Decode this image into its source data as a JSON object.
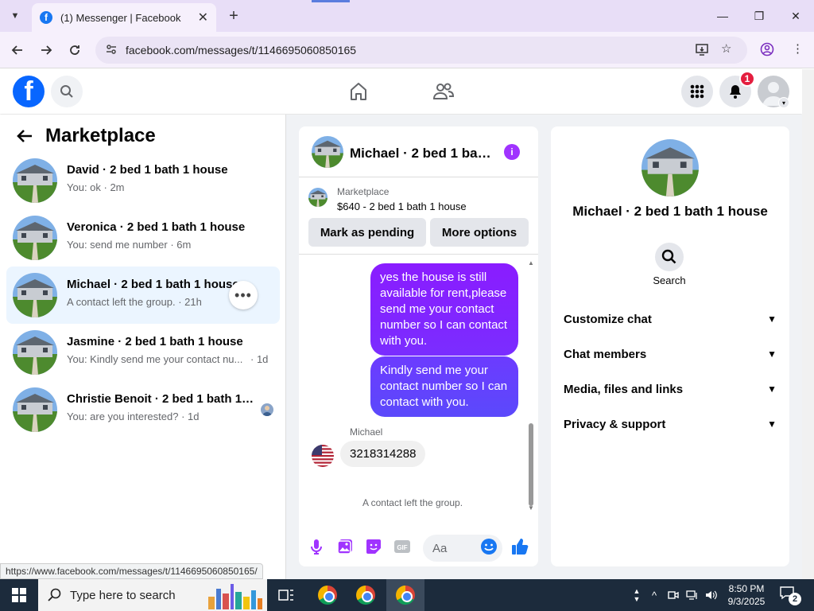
{
  "browser": {
    "tab_title": "(1) Messenger | Facebook",
    "tab_favicon": "facebook-icon",
    "new_tab_label": "+",
    "url": "facebook.com/messages/t/1146695060850165",
    "status_url": "https://www.facebook.com/messages/t/1146695060850165/"
  },
  "fb_header": {
    "logo_letter": "f",
    "notification_count": "1",
    "accent": "#0866ff",
    "badge_color": "#e41e3f"
  },
  "sidebar": {
    "title": "Marketplace",
    "conversations": [
      {
        "name": "David · 2 bed 1 bath 1 house",
        "preview": "You: ok · 2m",
        "time": ""
      },
      {
        "name": "Veronica · 2 bed 1 bath 1 house",
        "preview": "You: send me number · 6m",
        "time": ""
      },
      {
        "name": "Michael · 2 bed 1 bath 1 house",
        "preview": "A contact left the group. · 21h",
        "time": "",
        "active": true
      },
      {
        "name": "Jasmine · 2 bed 1 bath 1 house",
        "preview": "You: Kindly send me your contact nu...",
        "time": "· 1d"
      },
      {
        "name": "Christie Benoit · 2 bed 1 bath 1 h...",
        "preview": "You: are you interested? · 1d",
        "time": ""
      }
    ]
  },
  "chat": {
    "title": "Michael · 2 bed 1 bat...",
    "listing_label": "Marketplace",
    "listing_price": "$640 - 2 bed 1 bath 1 house",
    "mark_pending": "Mark as pending",
    "more_options": "More options",
    "messages": [
      {
        "from": "me",
        "text": "yes the house is still available for rent,please send me your contact number so I can contact with you."
      },
      {
        "from": "me",
        "text": "Kindly send me your contact number so I can contact with you."
      },
      {
        "from": "Michael",
        "text": "3218314288"
      }
    ],
    "sender_name": "Michael",
    "system_note": "A contact left the group.",
    "composer_placeholder": "Aa",
    "accent": "#a033ff"
  },
  "info_panel": {
    "name": "Michael · 2 bed 1 bath 1 house",
    "search_label": "Search",
    "sections": [
      "Customize chat",
      "Chat members",
      "Media, files and links",
      "Privacy & support"
    ]
  },
  "taskbar": {
    "search_placeholder": "Type here to search",
    "time": "8:50 PM",
    "date": "9/3/2025",
    "notification_count": "2"
  }
}
